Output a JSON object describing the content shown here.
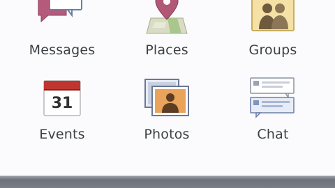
{
  "tiles": [
    {
      "label": "Messages",
      "icon": "messages-icon"
    },
    {
      "label": "Places",
      "icon": "places-icon"
    },
    {
      "label": "Groups",
      "icon": "groups-icon"
    },
    {
      "label": "Events",
      "icon": "events-icon",
      "calendar_day": "31"
    },
    {
      "label": "Photos",
      "icon": "photos-icon"
    },
    {
      "label": "Chat",
      "icon": "chat-icon"
    }
  ]
}
